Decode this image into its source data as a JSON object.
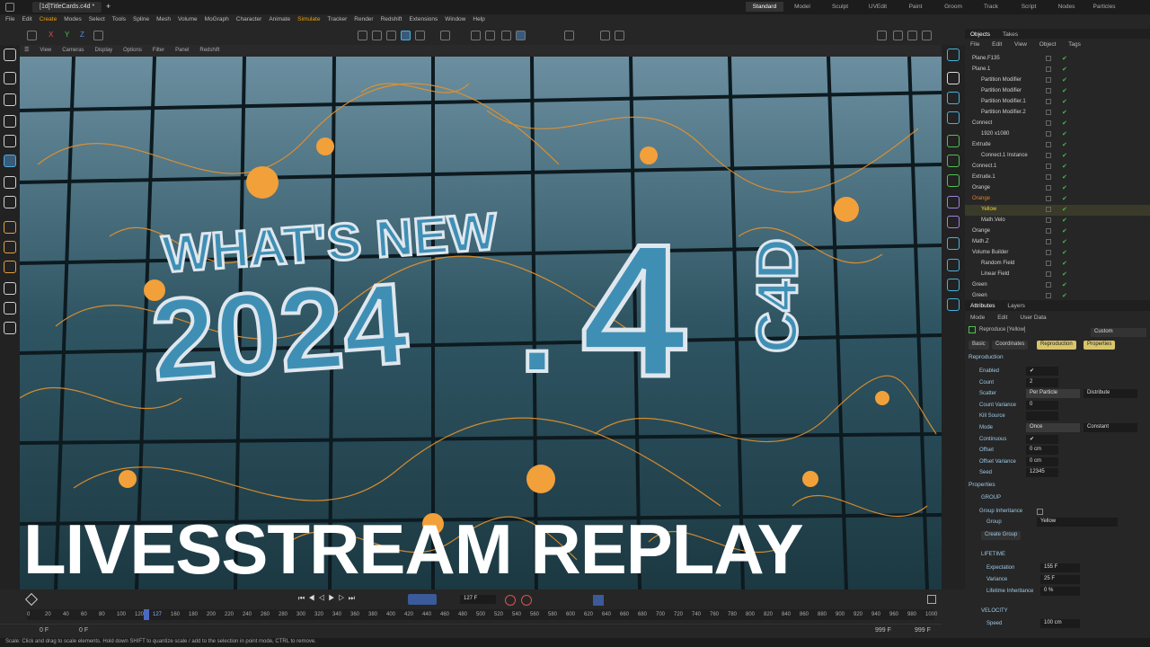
{
  "titlebar": {
    "doc_tab": "[1d]TitleCards.c4d *",
    "plus": "+"
  },
  "menubar": {
    "items": [
      "File",
      "Edit",
      "Create",
      "Modes",
      "Select",
      "Tools",
      "Spline",
      "Mesh",
      "Volume",
      "MoGraph",
      "Character",
      "Animate",
      "Simulate",
      "Tracker",
      "Render",
      "Redshift",
      "Extensions",
      "Window",
      "Help"
    ],
    "workspaces": [
      "Standard",
      "Model",
      "Sculpt",
      "UVEdit",
      "Paint",
      "Groom",
      "Track",
      "Script",
      "Nodes",
      "Particles"
    ]
  },
  "toolbar": {
    "axis": [
      "X",
      "Y",
      "Z"
    ]
  },
  "viewport_menu": [
    "View",
    "Cameras",
    "Display",
    "Options",
    "Filter",
    "Panel",
    "Redshift"
  ],
  "viewport": {
    "line1": "WHAT'S NEW",
    "line2": "2024",
    "dot": ".",
    "line3": "4",
    "badge": "C4D"
  },
  "banner": "LIVESSTREAM REPLAY",
  "objects": {
    "tabs": [
      "Objects",
      "Takes"
    ],
    "menu": [
      "File",
      "Edit",
      "View",
      "Object",
      "Tags"
    ],
    "rows": [
      {
        "name": "Plane.F135",
        "indent": 0
      },
      {
        "name": "Plane.1",
        "indent": 0
      },
      {
        "name": "Partition Modifier",
        "indent": 1
      },
      {
        "name": "Partition Modifier",
        "indent": 1
      },
      {
        "name": "Partition Modifier.1",
        "indent": 1
      },
      {
        "name": "Partition Modifier.2",
        "indent": 1
      },
      {
        "name": "Connect",
        "indent": 0
      },
      {
        "name": "1920 x1080",
        "indent": 1
      },
      {
        "name": "Extrude",
        "indent": 0
      },
      {
        "name": "Connect.1 Instance",
        "indent": 1
      },
      {
        "name": "Connect.1",
        "indent": 0
      },
      {
        "name": "Extrude.1",
        "indent": 0
      },
      {
        "name": "Orange",
        "indent": 0
      },
      {
        "name": "Orange",
        "indent": 0
      },
      {
        "name": "Yellow",
        "indent": 1
      },
      {
        "name": "Math.Velo",
        "indent": 1
      },
      {
        "name": "Orange",
        "indent": 0
      },
      {
        "name": "Math.Z",
        "indent": 0
      },
      {
        "name": "Volume Builder",
        "indent": 0
      },
      {
        "name": "Random Field",
        "indent": 1
      },
      {
        "name": "Linear Field",
        "indent": 1
      },
      {
        "name": "Green",
        "indent": 0
      },
      {
        "name": "Green",
        "indent": 0
      }
    ]
  },
  "attributes": {
    "tabs": [
      "Attributes",
      "Layers"
    ],
    "menu": [
      "Mode",
      "Edit",
      "User Data"
    ],
    "dropdown": "Custom",
    "object": "Reproduce [Yellow]",
    "subtabs": [
      "Basic",
      "Coordinates",
      "Reproduction",
      "Properties"
    ],
    "section": "Reproduction",
    "fields": [
      {
        "label": "Enabled",
        "value": "✔"
      },
      {
        "label": "Count",
        "value": "2"
      },
      {
        "label": "Scatter",
        "value": "Per Particle",
        "alt": "Distribute"
      },
      {
        "label": "Count Variance",
        "value": "0"
      },
      {
        "label": "Kill Source",
        "value": ""
      },
      {
        "label": "Mode",
        "value": "Once",
        "alt": "Constant"
      },
      {
        "label": "Continuous",
        "value": "✔"
      },
      {
        "label": "Offset",
        "value": "0 cm"
      },
      {
        "label": "Offset Variance",
        "value": "0 cm"
      },
      {
        "label": "Seed",
        "value": "12345"
      }
    ],
    "properties": "Properties",
    "group_header": "GROUP",
    "group_inherit": "Group Inheritance",
    "group_label": "Group",
    "group_value": "Yellow",
    "create_group": "Create Group",
    "lifetime_header": "LIFETIME",
    "lifetime": [
      {
        "label": "Expectation",
        "value": "155 F"
      },
      {
        "label": "Variance",
        "value": "25 F"
      },
      {
        "label": "Lifetime Inheritance",
        "value": "0 %"
      }
    ],
    "velocity_header": "VELOCITY",
    "speed_label": "Speed",
    "speed_value": "100 cm"
  },
  "timeline": {
    "frame": "127 F",
    "start": "0 F",
    "start2": "0 F",
    "end": "999 F",
    "end2": "999 F",
    "ticks": [
      "0",
      "20",
      "40",
      "60",
      "80",
      "100",
      "120",
      "127",
      "160",
      "180",
      "200",
      "220",
      "240",
      "260",
      "280",
      "300",
      "320",
      "340",
      "360",
      "380",
      "400",
      "420",
      "440",
      "460",
      "480",
      "500",
      "520",
      "540",
      "560",
      "580",
      "600",
      "620",
      "640",
      "660",
      "680",
      "700",
      "720",
      "740",
      "760",
      "780",
      "800",
      "820",
      "840",
      "860",
      "880",
      "900",
      "920",
      "940",
      "960",
      "980",
      "1000"
    ]
  },
  "statusbar": "Scale: Click and drag to scale elements. Hold down SHIFT to quantize scale / add to the selection in point mode, CTRL to remove."
}
